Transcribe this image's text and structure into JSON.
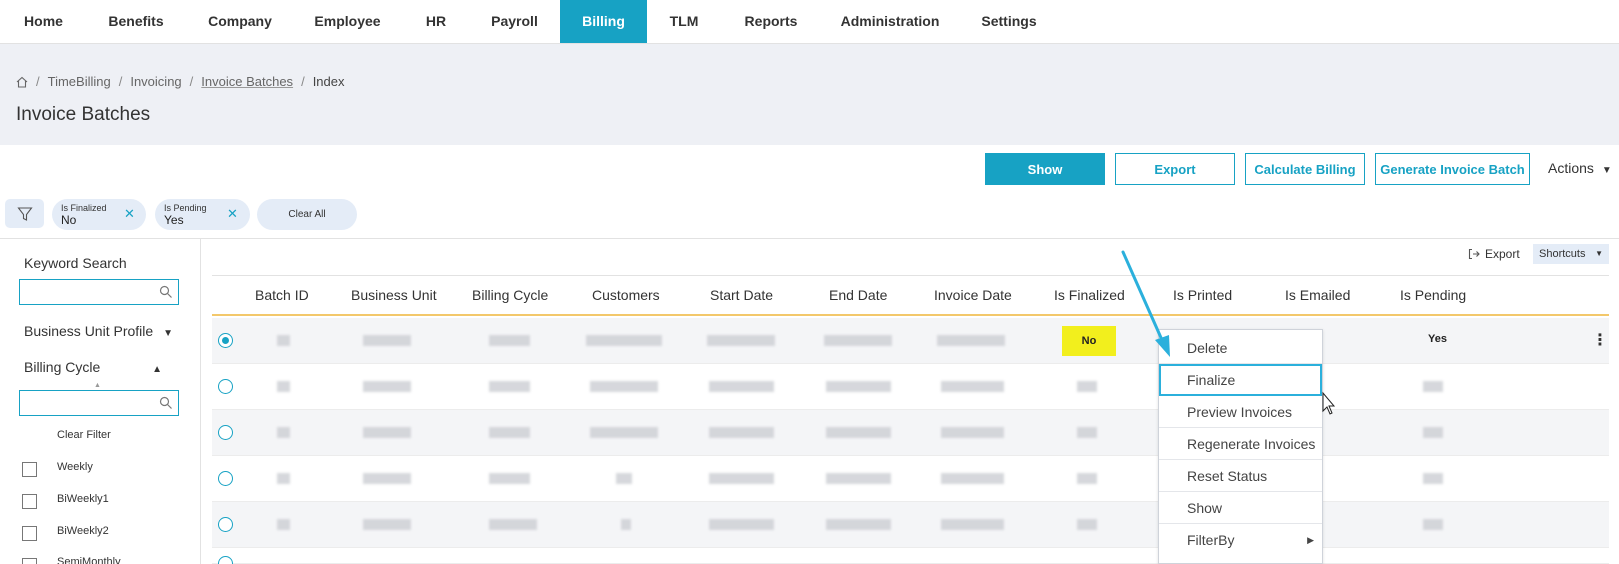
{
  "nav": {
    "items": [
      "Home",
      "Benefits",
      "Company",
      "Employee",
      "HR",
      "Payroll",
      "Billing",
      "TLM",
      "Reports",
      "Administration",
      "Settings"
    ],
    "active_index": 6
  },
  "breadcrumb": {
    "home_icon": "home-icon",
    "items": [
      "TimeBilling",
      "Invoicing",
      "Invoice Batches",
      "Index"
    ]
  },
  "page_title": "Invoice Batches",
  "toolbar": {
    "show": "Show",
    "export": "Export",
    "calculate_billing": "Calculate Billing",
    "generate_invoice_batch": "Generate Invoice Batch",
    "actions": "Actions"
  },
  "filters": {
    "chips": [
      {
        "label": "Is Finalized",
        "value": "No"
      },
      {
        "label": "Is Pending",
        "value": "Yes"
      }
    ],
    "clear_all": "Clear All"
  },
  "sidebar": {
    "keyword_search": "Keyword Search",
    "business_unit_profile": "Business Unit Profile",
    "billing_cycle": "Billing Cycle",
    "clear_filter": "Clear Filter",
    "options": [
      "Weekly",
      "BiWeekly1",
      "BiWeekly2",
      "SemiMonthly"
    ]
  },
  "table": {
    "export": "Export",
    "shortcuts": "Shortcuts",
    "columns": [
      "Batch ID",
      "Business Unit",
      "Billing Cycle",
      "Customers",
      "Start Date",
      "End Date",
      "Invoice Date",
      "Is Finalized",
      "Is Printed",
      "Is Emailed",
      "Is Pending"
    ],
    "first_row": {
      "is_finalized": "No",
      "is_pending": "Yes"
    }
  },
  "context_menu": {
    "items": [
      "Delete",
      "Finalize",
      "Preview Invoices",
      "Regenerate Invoices",
      "Reset Status",
      "Show",
      "FilterBy"
    ],
    "highlighted_index": 1
  },
  "colors": {
    "accent": "#17a2c4",
    "highlight": "#f2ef1d",
    "callout": "#2bb0dc"
  }
}
